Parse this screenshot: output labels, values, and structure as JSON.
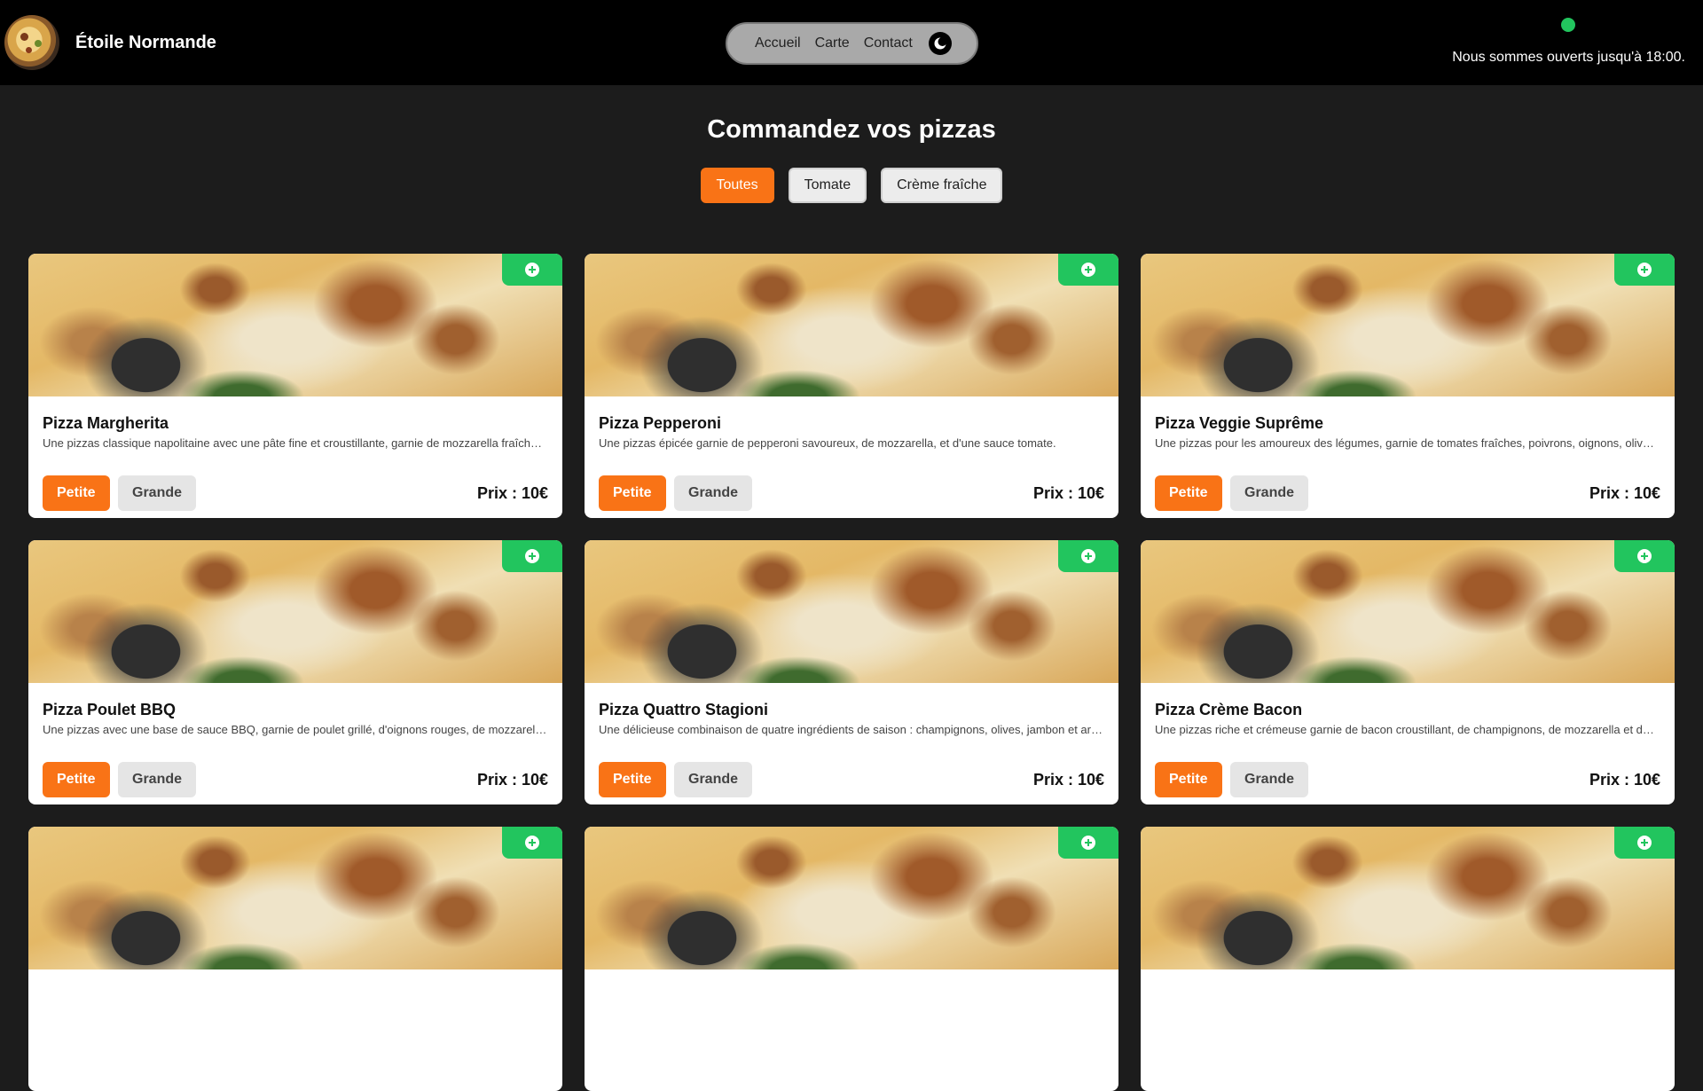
{
  "header": {
    "brand": "Étoile Normande",
    "nav": [
      "Accueil",
      "Carte",
      "Contact"
    ],
    "theme_icon": "moon-icon",
    "status_text": "Nous sommes ouverts jusqu'à 18:00.",
    "status_color": "#22c55e"
  },
  "main": {
    "title": "Commandez vos pizzas",
    "filters": [
      {
        "label": "Toutes",
        "active": true
      },
      {
        "label": "Tomate",
        "active": false
      },
      {
        "label": "Crème fraîche",
        "active": false
      }
    ]
  },
  "labels": {
    "petite": "Petite",
    "grande": "Grande"
  },
  "colors": {
    "accent": "#f97316",
    "add": "#22c55e",
    "background": "#1c1c1c"
  },
  "pizzas": [
    {
      "name": "Pizza Margherita",
      "description": "Une pizzas classique napolitaine avec une pâte fine et croustillante, garnie de mozzarella fraîche, de tomates et de basilic.",
      "price": "Prix : 10€"
    },
    {
      "name": "Pizza Pepperoni",
      "description": "Une pizzas épicée garnie de pepperoni savoureux, de mozzarella, et d'une sauce tomate.",
      "price": "Prix : 10€"
    },
    {
      "name": "Pizza Veggie Suprême",
      "description": "Une pizzas pour les amoureux des légumes, garnie de tomates fraîches, poivrons, oignons, olives et champignons.",
      "price": "Prix : 10€"
    },
    {
      "name": "Pizza Poulet BBQ",
      "description": "Une pizzas avec une base de sauce BBQ, garnie de poulet grillé, d'oignons rouges, de mozzarella et de coriandre.",
      "price": "Prix : 10€"
    },
    {
      "name": "Pizza Quattro Stagioni",
      "description": "Une délicieuse combinaison de quatre ingrédients de saison : champignons, olives, jambon et artichauts.",
      "price": "Prix : 10€"
    },
    {
      "name": "Pizza Crème Bacon",
      "description": "Une pizzas riche et crémeuse garnie de bacon croustillant, de champignons, de mozzarella et de crème fraîche.",
      "price": "Prix : 10€"
    },
    {
      "name": "",
      "description": "",
      "price": ""
    },
    {
      "name": "",
      "description": "",
      "price": ""
    },
    {
      "name": "",
      "description": "",
      "price": ""
    }
  ]
}
